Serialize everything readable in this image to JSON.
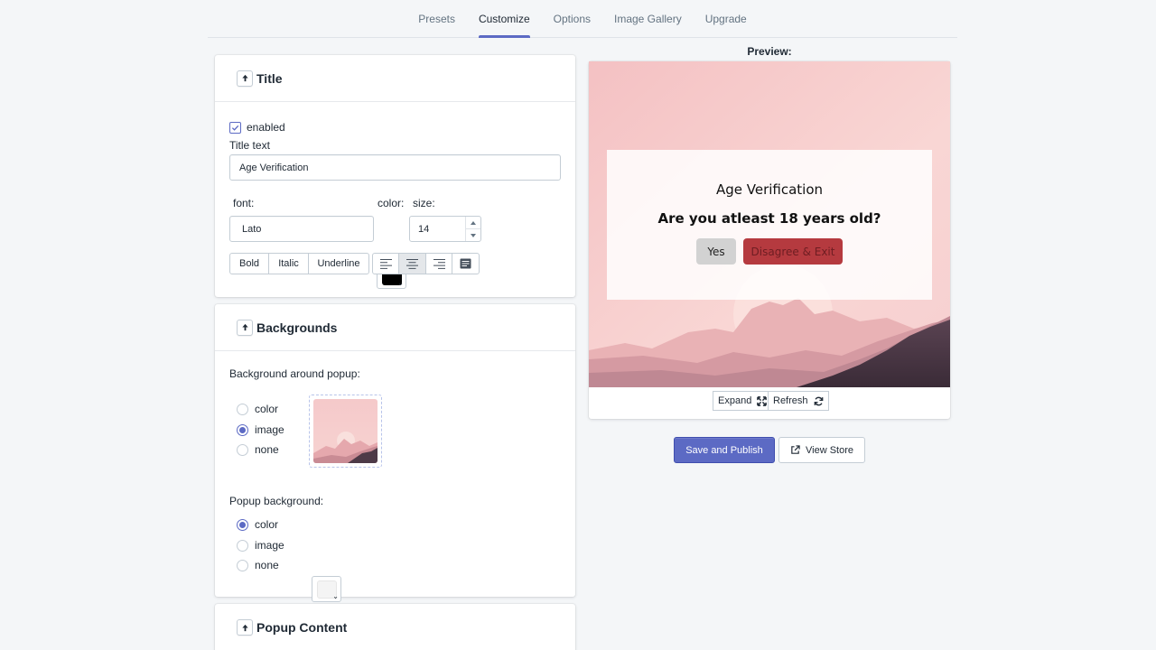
{
  "nav": {
    "tabs": [
      {
        "label": "Presets"
      },
      {
        "label": "Customize"
      },
      {
        "label": "Options"
      },
      {
        "label": "Image Gallery"
      },
      {
        "label": "Upgrade"
      }
    ],
    "active": "Customize"
  },
  "title_section": {
    "heading": "Title",
    "enabled_label": "enabled",
    "enabled": true,
    "title_text_label": "Title text",
    "title_text_value": "Age Verification",
    "font_label": "font:",
    "font_value": "Lato",
    "color_label": "color:",
    "color_value": "#000000",
    "size_label": "size:",
    "size_value": "14",
    "style_buttons": {
      "bold": "Bold",
      "italic": "Italic",
      "underline": "Underline"
    },
    "align_active": "center"
  },
  "backgrounds": {
    "heading": "Backgrounds",
    "around_label": "Background around popup:",
    "around_options": [
      "color",
      "image",
      "none"
    ],
    "around_selected": "image",
    "popup_label": "Popup background:",
    "popup_options": [
      "color",
      "image",
      "none"
    ],
    "popup_selected": "color",
    "popup_color": "#f4f4f4"
  },
  "popup_content": {
    "heading": "Popup Content"
  },
  "preview": {
    "label": "Preview:",
    "popup_title": "Age Verification",
    "popup_question": "Are you atleast 18 years old?",
    "yes_label": "Yes",
    "exit_label": "Disagree & Exit",
    "expand_label": "Expand",
    "refresh_label": "Refresh"
  },
  "actions": {
    "save_label": "Save and Publish",
    "view_store_label": "View Store"
  },
  "colors": {
    "accent": "#5c6ac4",
    "exit_button": "#b53a3f",
    "page_bg": "#f4f6f8"
  }
}
